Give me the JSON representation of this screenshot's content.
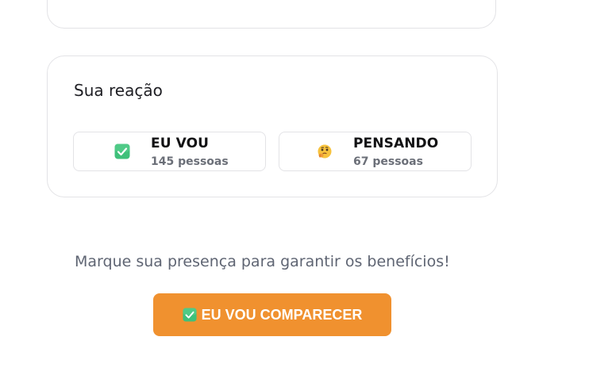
{
  "reaction_card": {
    "title": "Sua reação",
    "options": [
      {
        "label": "EU VOU",
        "count": "145 pessoas",
        "icon": "check-mark-button-icon"
      },
      {
        "label": "PENSANDO",
        "count": "67 pessoas",
        "icon": "thinking-face-icon"
      }
    ]
  },
  "prompt": {
    "text": "Marque sua presença para garantir os benefícios!"
  },
  "cta": {
    "label": "EU VOU COMPARECER",
    "icon": "check-mark-button-icon",
    "color": "#f0912f"
  },
  "colors": {
    "accent": "#f0912f",
    "check_green": "#3fc07a"
  }
}
